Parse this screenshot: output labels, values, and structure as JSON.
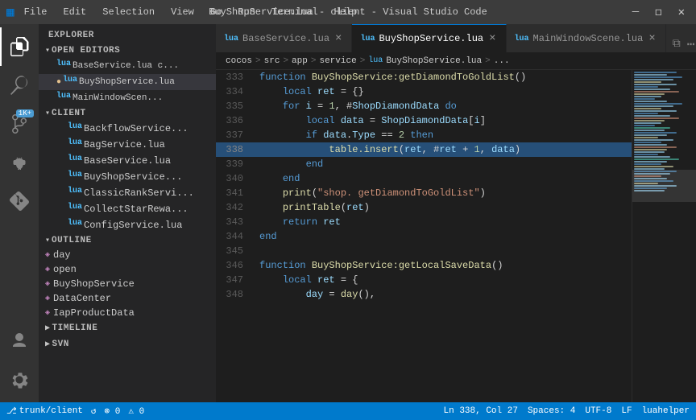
{
  "titleBar": {
    "logo": "⟨⟩",
    "menu": [
      "File",
      "Edit",
      "Selection",
      "View",
      "Go",
      "Run",
      "Terminal",
      "Help"
    ],
    "title": "BuyShopService.lua - client - Visual Studio Code",
    "controls": [
      "—",
      "❐",
      "✕"
    ]
  },
  "activityBar": {
    "icons": [
      {
        "name": "explorer-icon",
        "symbol": "⎘",
        "active": true,
        "badge": null
      },
      {
        "name": "search-icon",
        "symbol": "🔍",
        "active": false
      },
      {
        "name": "source-control-icon",
        "symbol": "⎇",
        "active": false,
        "badge": "1K+"
      },
      {
        "name": "debug-icon",
        "symbol": "▶",
        "active": false
      },
      {
        "name": "extensions-icon",
        "symbol": "⊞",
        "active": false
      }
    ],
    "bottomIcons": [
      {
        "name": "account-icon",
        "symbol": "👤"
      },
      {
        "name": "settings-icon",
        "symbol": "⚙"
      }
    ]
  },
  "sidebar": {
    "explorerTitle": "EXPLORER",
    "openEditors": {
      "title": "OPEN EDITORS",
      "items": [
        {
          "name": "BaseService.lua",
          "label": "BaseService.lua  c...",
          "modified": false
        },
        {
          "name": "BuyShopService.lua",
          "label": "BuyShopService.lua",
          "modified": true,
          "active": true
        },
        {
          "name": "MainWindowScene.lua",
          "label": "MainWindowScen...",
          "modified": false
        }
      ]
    },
    "client": {
      "title": "CLIENT",
      "items": [
        {
          "name": "BackflowService.lua",
          "label": "BackflowService..."
        },
        {
          "name": "BagService.lua",
          "label": "BagService.lua"
        },
        {
          "name": "BaseService.lua",
          "label": "BaseService.lua"
        },
        {
          "name": "BuyShopService.lua",
          "label": "BuyShopService..."
        },
        {
          "name": "ClassicRankService.lua",
          "label": "ClassicRankServi..."
        },
        {
          "name": "CollectStarReward.lua",
          "label": "CollectStarRewa..."
        },
        {
          "name": "ConfigService.lua",
          "label": "ConfigService.lua"
        }
      ]
    },
    "outline": {
      "title": "OUTLINE",
      "items": [
        {
          "name": "day",
          "label": "day"
        },
        {
          "name": "open",
          "label": "open"
        },
        {
          "name": "BuyShopService",
          "label": "BuyShopService"
        },
        {
          "name": "DataCenter",
          "label": "DataCenter"
        },
        {
          "name": "IapProductData",
          "label": "IapProductData"
        }
      ]
    },
    "timeline": {
      "title": "TIMELINE"
    },
    "svn": {
      "title": "SVN"
    }
  },
  "tabs": [
    {
      "label": "BaseService.lua",
      "active": false,
      "modified": false,
      "icon": "📄"
    },
    {
      "label": "BuyShopService.lua",
      "active": true,
      "modified": true,
      "icon": "📄"
    },
    {
      "label": "MainWindowScene.lua",
      "active": false,
      "modified": false,
      "icon": "📄"
    }
  ],
  "breadcrumb": {
    "parts": [
      "cocos",
      "src",
      "app",
      "service",
      "BuyShopService.lua",
      "..."
    ]
  },
  "code": {
    "lines": [
      {
        "num": 333,
        "content": "function BuyShopService:getDiamondToGoldList()",
        "highlight": false
      },
      {
        "num": 334,
        "content": "    local ret = {}",
        "highlight": false
      },
      {
        "num": 335,
        "content": "    for i = 1, #ShopDiamondData do",
        "highlight": false
      },
      {
        "num": 336,
        "content": "        local data = ShopDiamondData[i]",
        "highlight": false
      },
      {
        "num": 337,
        "content": "        if data.Type == 2 then",
        "highlight": false
      },
      {
        "num": 338,
        "content": "            table.insert(ret, #ret + 1, data)",
        "highlight": true
      },
      {
        "num": 339,
        "content": "        end",
        "highlight": false
      },
      {
        "num": 340,
        "content": "    end",
        "highlight": false
      },
      {
        "num": 341,
        "content": "    print(\"shop. getDiamondToGoldList\")",
        "highlight": false
      },
      {
        "num": 342,
        "content": "    printTable(ret)",
        "highlight": false
      },
      {
        "num": 343,
        "content": "    return ret",
        "highlight": false
      },
      {
        "num": 344,
        "content": "end",
        "highlight": false
      },
      {
        "num": 345,
        "content": "",
        "highlight": false
      },
      {
        "num": 346,
        "content": "function BuyShopService:getLocalSaveData()",
        "highlight": false
      },
      {
        "num": 347,
        "content": "    local ret = {",
        "highlight": false
      },
      {
        "num": 348,
        "content": "        day = day(),",
        "highlight": false
      }
    ]
  },
  "statusBar": {
    "left": {
      "branch": "trunk/client",
      "sync": "↺",
      "errors": "⊗ 0",
      "warnings": "⚠ 0"
    },
    "right": {
      "position": "Ln 338, Col 27",
      "spaces": "Spaces: 4",
      "encoding": "UTF-8",
      "lineEnding": "LF",
      "language": "luahelper"
    }
  }
}
